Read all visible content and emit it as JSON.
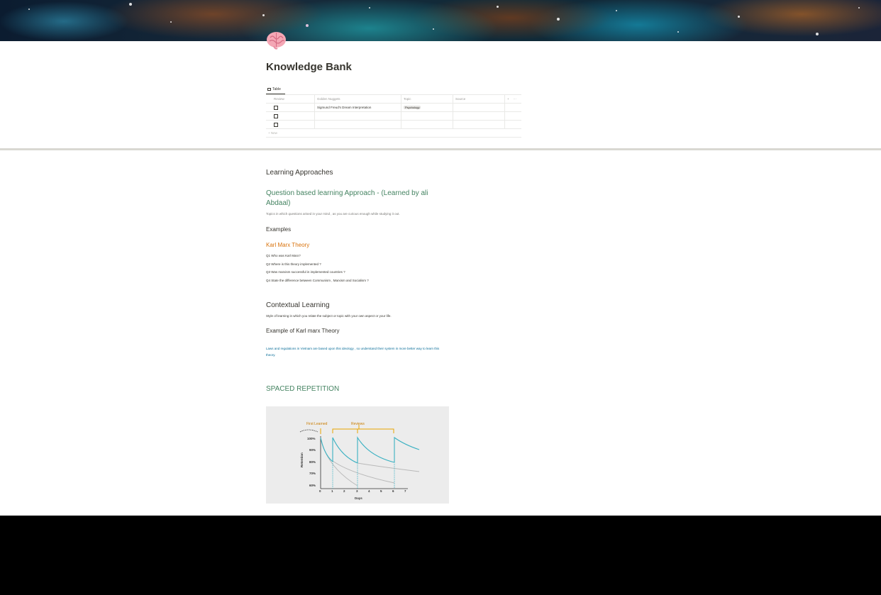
{
  "page": {
    "title": "Knowledge Bank",
    "icon": "brain-icon"
  },
  "database": {
    "view_tab_label": "Table",
    "columns": [
      "Review",
      "Golden Nuggets",
      "Topic",
      "Source"
    ],
    "rows": [
      {
        "review": false,
        "golden_nugget": "Sigmund Freud's Dream Interpretation",
        "topic": "Psychology",
        "source": ""
      },
      {
        "review": false,
        "golden_nugget": "",
        "topic": "",
        "source": ""
      },
      {
        "review": false,
        "golden_nugget": "",
        "topic": "",
        "source": ""
      }
    ],
    "new_row_label": "+ New",
    "add_column_label": "+",
    "more_label": "···"
  },
  "sections": {
    "learning_approaches": "Learning Approaches",
    "qba_heading": "Question based learning Approach - (Learned by ali Abdaal)",
    "qba_text": "Topics in which questions arised in your mind , as you are curious enough while studying it out.",
    "examples_heading": "Examples",
    "karl_heading": "Karl Marx Theory",
    "questions": [
      "Q1 Who was Karl Marx?",
      "Q2 Where is this theory implemented ?",
      "Q3 Was marxism successful in implemented countries ?",
      "Q4 State the difference between Communism , Marxism and Socialism ?"
    ],
    "contextual_heading": "Contextual Learning",
    "contextual_text": "Style of learning in which you relate the subject or topic with your own aspect or your life.",
    "example_km_heading": "Example of Karl marx Theory",
    "laws_text": "Laws and regulations in Vietnam are based upon this ideology , so understand their system in more better way to learn this theory.",
    "spaced_heading": "SPACED REPETITION"
  },
  "chart_image": {
    "first_learned_label": "First Learned",
    "reviews_label": "Reviews",
    "ylabel": "Retention",
    "xlabel": "Days",
    "y_ticks": [
      "100%",
      "90%",
      "80%",
      "70%",
      "60%"
    ],
    "x_ticks": [
      "0",
      "1",
      "2",
      "3",
      "4",
      "5",
      "6",
      "7"
    ],
    "colors": {
      "accent": "#e8a300",
      "curve": "#3ab1c2",
      "forgetting": "#b8b8b8"
    }
  },
  "colors": {
    "green_heading": "#448361",
    "orange_heading": "#d9730d",
    "blue_text": "#0b6e99",
    "text": "#37352f"
  }
}
